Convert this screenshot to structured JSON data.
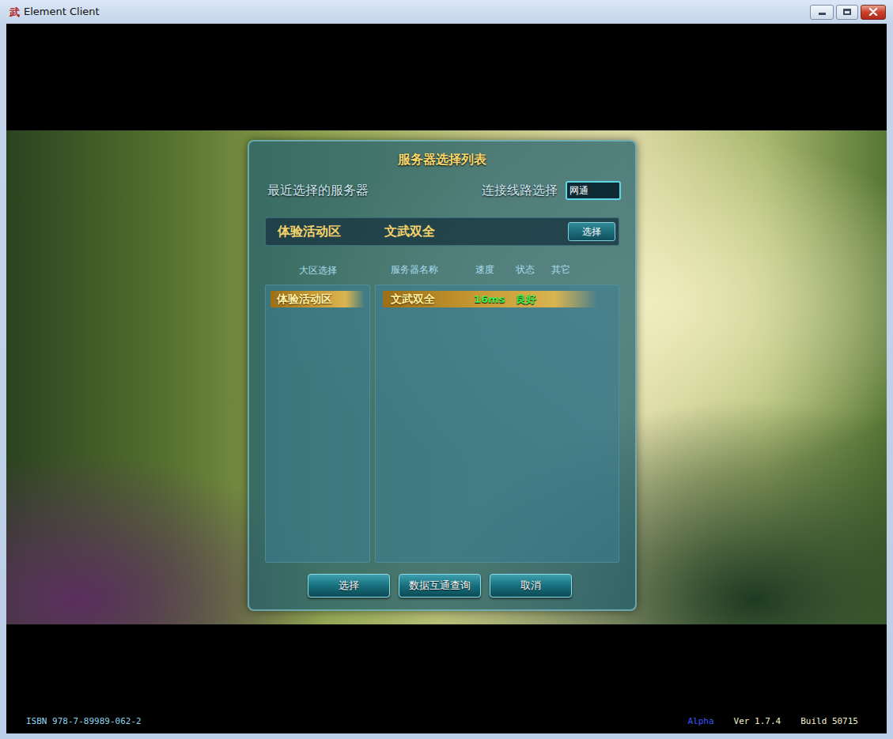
{
  "window": {
    "title": "Element Client",
    "icon": "武"
  },
  "dialog": {
    "title": "服务器选择列表",
    "recent_label": "最近选择的服务器",
    "line_label": "连接线路选择",
    "line_value": "网通",
    "recent": {
      "zone": "体验活动区",
      "server": "文武双全",
      "button": "选择"
    },
    "zone_header": "大区选择",
    "server_columns": [
      "服务器名称",
      "速度",
      "状态",
      "其它"
    ],
    "zones": [
      {
        "name": "体验活动区",
        "selected": true
      }
    ],
    "servers": [
      {
        "name": "文武双全",
        "speed": "16ms",
        "status": "良好",
        "selected": true
      }
    ],
    "buttons": [
      "选择",
      "数据互通查询",
      "取消"
    ]
  },
  "footer": {
    "isbn": "ISBN 978-7-89989-062-2",
    "stage": "Alpha",
    "version": "Ver 1.7.4",
    "build": "Build 50715"
  }
}
